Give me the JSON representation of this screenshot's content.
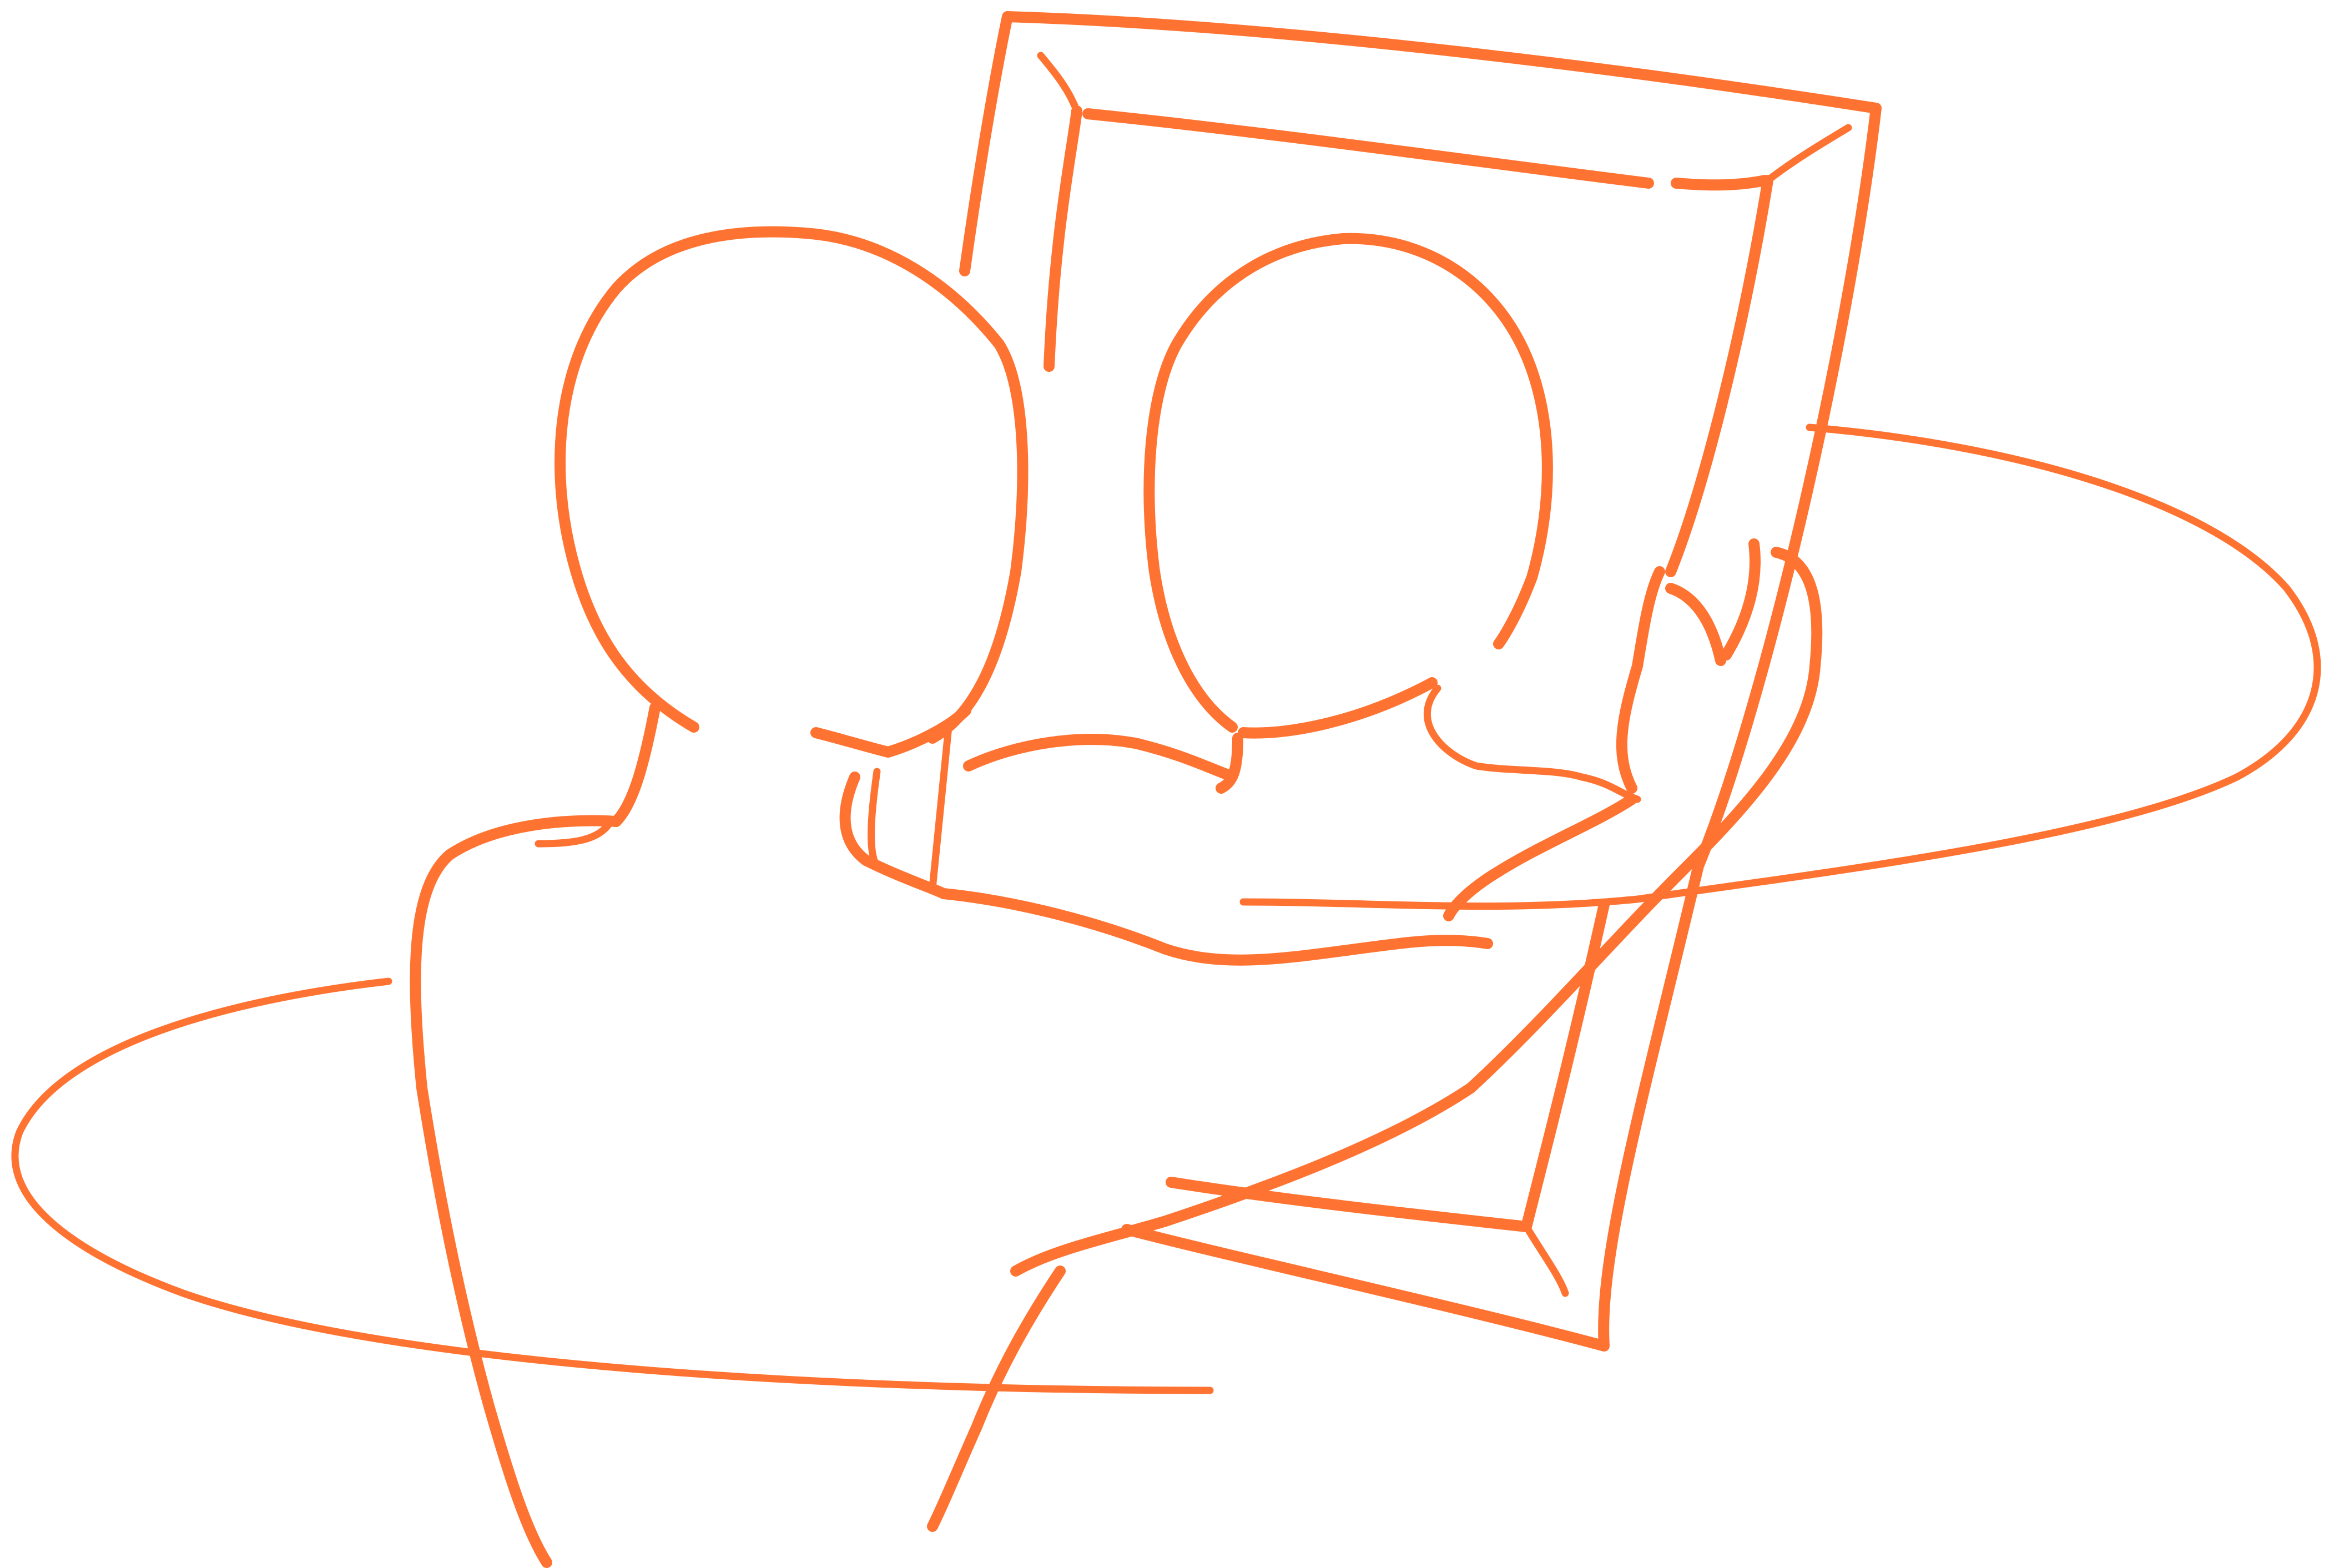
{
  "illustration": {
    "icon": "person-holding-framed-portrait-icon",
    "accent_color": "#FF7332",
    "background_color": "#FFFFFF"
  }
}
